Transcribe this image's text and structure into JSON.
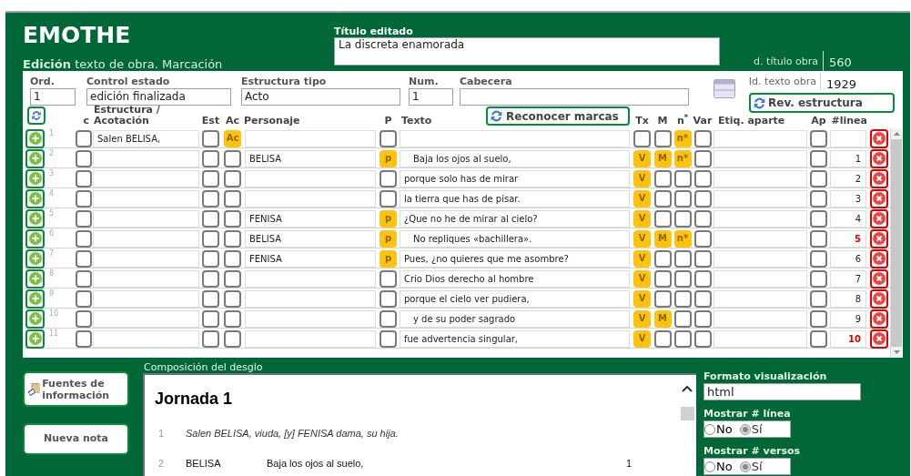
{
  "app": {
    "title": "EMOTHE",
    "subtitle": "**Edición** texto de obra. Marcación"
  },
  "titulo_editado": {
    "label": "Título editado",
    "value": "La discreta enamorada"
  },
  "id_titulo_obra": {
    "label": "d. título obra",
    "value": "560"
  },
  "id_texto_obra": {
    "label": "Id. texto obra",
    "value": "1929"
  },
  "fields": [
    {
      "label": "Ord.",
      "value": "1"
    },
    {
      "label": "Control estado",
      "value": "edición finalizada"
    },
    {
      "label": "Estructura tipo",
      "value": "Acto"
    },
    {
      "label": "Num.",
      "value": "1"
    },
    {
      "label": "Cabecera"
    }
  ],
  "rev_button": "Rev. estructura",
  "reconocer_button": "Reconocer marcas",
  "columns": {
    "c": "c",
    "estructura": "Estructura /\nAcotación",
    "est": "Est",
    "ac": "Ac",
    "personaje": "Personaje",
    "p": "P",
    "texto": "Texto",
    "tx": "Tx",
    "m": "M",
    "n": "n$^{*}$",
    "var": "Var",
    "etiq": "Etiq. aparte",
    "ap": "Ap",
    "linea": "#linea"
  },
  "rows": [
    {
      "num": "1",
      "c": {
        "checked": false
      },
      "estructura": "Salen BELISA,",
      "est": {
        "checked": false
      },
      "ac": {
        "checked": true,
        "label": "Ac"
      },
      "p": {
        "checked": false
      },
      "tx": {
        "checked": false
      },
      "m": {
        "checked": false
      },
      "n": {
        "checked": true,
        "label": "n*"
      },
      "var": {
        "checked": false
      },
      "ap": {
        "checked": false
      }
    },
    {
      "num": "2",
      "c": {
        "checked": false
      },
      "est": {
        "checked": false
      },
      "ac": {
        "checked": false
      },
      "personaje": "BELISA",
      "p": {
        "checked": true,
        "label": "p"
      },
      "texto": "Baja los ojos al suelo,",
      "indented": true,
      "tx": {
        "checked": true,
        "label": "V"
      },
      "m": {
        "checked": true,
        "label": "M"
      },
      "n": {
        "checked": true,
        "label": "n*"
      },
      "var": {
        "checked": false
      },
      "ap": {
        "checked": false
      },
      "linea": "1",
      "flagged": false
    },
    {
      "num": "3",
      "c": {
        "checked": false
      },
      "est": {
        "checked": false
      },
      "ac": {
        "checked": false
      },
      "p": {
        "checked": false
      },
      "texto": "porque solo has de mirar",
      "indented": false,
      "tx": {
        "checked": true,
        "label": "V"
      },
      "m": {
        "checked": false
      },
      "n": {
        "checked": false
      },
      "var": {
        "checked": false
      },
      "ap": {
        "checked": false
      },
      "linea": "2",
      "flagged": false
    },
    {
      "num": "4",
      "c": {
        "checked": false
      },
      "est": {
        "checked": false
      },
      "ac": {
        "checked": false
      },
      "p": {
        "checked": false
      },
      "texto": "la tierra que has de pisar.",
      "indented": false,
      "tx": {
        "checked": true,
        "label": "V"
      },
      "m": {
        "checked": false
      },
      "n": {
        "checked": false
      },
      "var": {
        "checked": false
      },
      "ap": {
        "checked": false
      },
      "linea": "3",
      "flagged": false
    },
    {
      "num": "5",
      "c": {
        "checked": false
      },
      "est": {
        "checked": false
      },
      "ac": {
        "checked": false
      },
      "personaje": "FENISA",
      "p": {
        "checked": true,
        "label": "p"
      },
      "texto": "¿Que no he de mirar al cielo?",
      "indented": false,
      "tx": {
        "checked": true,
        "label": "V"
      },
      "m": {
        "checked": false
      },
      "n": {
        "checked": false
      },
      "var": {
        "checked": false
      },
      "ap": {
        "checked": false
      },
      "linea": "4",
      "flagged": false
    },
    {
      "num": "6",
      "c": {
        "checked": false
      },
      "est": {
        "checked": false
      },
      "ac": {
        "checked": false
      },
      "personaje": "BELISA",
      "p": {
        "checked": true,
        "label": "p"
      },
      "texto": "No repliques «bachillera».",
      "indented": true,
      "tx": {
        "checked": true,
        "label": "V"
      },
      "m": {
        "checked": true,
        "label": "M"
      },
      "n": {
        "checked": true,
        "label": "n*"
      },
      "var": {
        "checked": false
      },
      "ap": {
        "checked": false
      },
      "linea": "5",
      "flagged": true
    },
    {
      "num": "7",
      "c": {
        "checked": false
      },
      "est": {
        "checked": false
      },
      "ac": {
        "checked": false
      },
      "personaje": "FENISA",
      "p": {
        "checked": true,
        "label": "p"
      },
      "texto": "Pues, ¿no quieres que me asombre?",
      "indented": false,
      "tx": {
        "checked": true,
        "label": "V"
      },
      "m": {
        "checked": false
      },
      "n": {
        "checked": false
      },
      "var": {
        "checked": false
      },
      "ap": {
        "checked": false
      },
      "linea": "6",
      "flagged": false
    },
    {
      "num": "8",
      "c": {
        "checked": false
      },
      "est": {
        "checked": false
      },
      "ac": {
        "checked": false
      },
      "p": {
        "checked": false
      },
      "texto": "Crio Dios derecho al hombre",
      "indented": false,
      "tx": {
        "checked": true,
        "label": "V"
      },
      "m": {
        "checked": false
      },
      "n": {
        "checked": false
      },
      "var": {
        "checked": false
      },
      "ap": {
        "checked": false
      },
      "linea": "7",
      "flagged": false
    },
    {
      "num": "9",
      "c": {
        "checked": false
      },
      "est": {
        "checked": false
      },
      "ac": {
        "checked": false
      },
      "p": {
        "checked": false
      },
      "texto": "porque el cielo ver pudiera,",
      "indented": false,
      "tx": {
        "checked": true,
        "label": "V"
      },
      "m": {
        "checked": false
      },
      "n": {
        "checked": false
      },
      "var": {
        "checked": false
      },
      "ap": {
        "checked": false
      },
      "linea": "8",
      "flagged": false
    },
    {
      "num": "10",
      "c": {
        "checked": false
      },
      "est": {
        "checked": false
      },
      "ac": {
        "checked": false
      },
      "p": {
        "checked": false
      },
      "texto": "y de su poder sagrado",
      "indented": true,
      "tx": {
        "checked": true,
        "label": "V"
      },
      "m": {
        "checked": true,
        "label": "M"
      },
      "n": {
        "checked": false
      },
      "var": {
        "checked": false
      },
      "ap": {
        "checked": false
      },
      "linea": "9",
      "flagged": false
    },
    {
      "num": "11",
      "c": {
        "checked": false
      },
      "est": {
        "checked": false
      },
      "ac": {
        "checked": false
      },
      "p": {
        "checked": false
      },
      "texto": "fue advertencia singular,",
      "indented": false,
      "tx": {
        "checked": true,
        "label": "V"
      },
      "m": {
        "checked": false
      },
      "n": {
        "checked": false
      },
      "var": {
        "checked": false
      },
      "ap": {
        "checked": false
      },
      "linea": "10",
      "flagged": true
    }
  ],
  "side_buttons": [
    "Fuentes de información",
    "Nueva nota"
  ],
  "composicion": {
    "label": "Composición del desglo",
    "heading": "Jornada 1",
    "lines": [
      {
        "kind": "stage",
        "num": "1",
        "text": "Salen BELISA, viuda, [y] FENISA dama, su hija."
      },
      {
        "kind": "verse",
        "num": "2",
        "speaker": "BELISA",
        "text": "Baja los ojos al suelo,",
        "verse": "1"
      }
    ]
  },
  "formato": {
    "label": "Formato visualización",
    "value": "html"
  },
  "options": [
    {
      "label": "Mostrar # línea",
      "choices": [
        {
          "label": "No",
          "selected": false
        },
        {
          "label": "Sí",
          "selected": true
        }
      ]
    },
    {
      "label": "Mostrar # versos",
      "choices": [
        {
          "label": "No",
          "selected": false
        },
        {
          "label": "Sí",
          "selected": true
        }
      ]
    }
  ]
}
